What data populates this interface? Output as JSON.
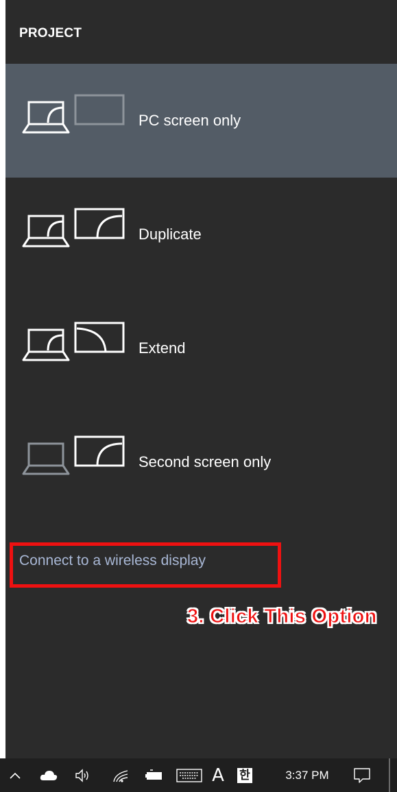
{
  "panel": {
    "title": "PROJECT",
    "options": [
      {
        "label": "PC screen only",
        "icon": "pc-screen-only-icon",
        "selected": true
      },
      {
        "label": "Duplicate",
        "icon": "duplicate-icon",
        "selected": false
      },
      {
        "label": "Extend",
        "icon": "extend-icon",
        "selected": false
      },
      {
        "label": "Second screen only",
        "icon": "second-screen-only-icon",
        "selected": false
      }
    ],
    "wireless_link": "Connect to a wireless display"
  },
  "annotation": {
    "text": "3. Click  This Option",
    "color": "#ee1111"
  },
  "taskbar": {
    "language": "A",
    "ime": "한",
    "time": "3:37 PM",
    "icons": [
      "chevron-up-icon",
      "onedrive-cloud-icon",
      "volume-icon",
      "wifi-icon",
      "battery-icon",
      "touch-keyboard-icon",
      "language-icon",
      "ime-icon",
      "notification-icon"
    ]
  },
  "colors": {
    "panel_bg": "#2b2b2b",
    "selected_bg": "#535c66",
    "link": "#a9b8d6",
    "taskbar_bg": "#1f1f1f"
  }
}
